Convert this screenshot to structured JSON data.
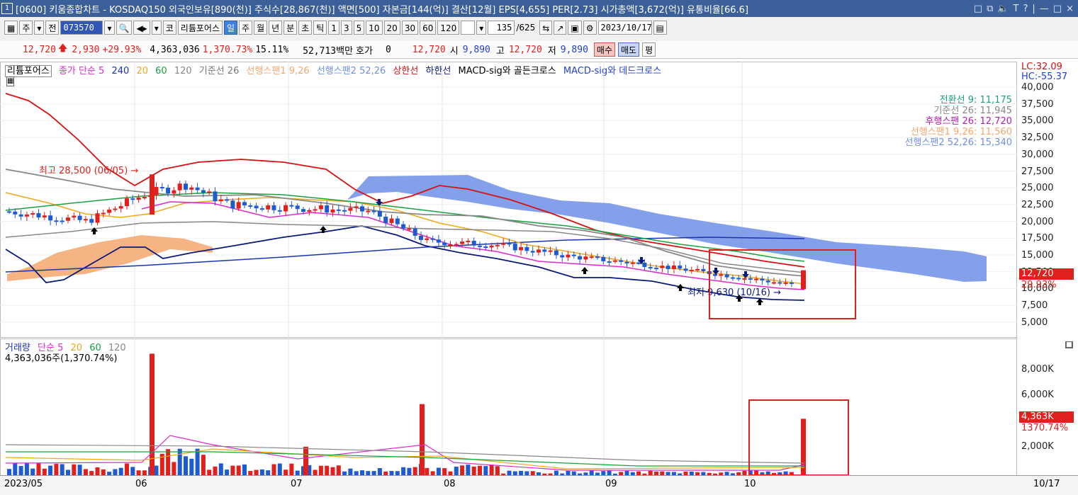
{
  "window": {
    "icon": "1",
    "title": "[0600] 키움종합차트 - KOSDAQ150 외국인보유[890(천)] 주식수[28,867(천)] 액면[500] 자본금[144(억)] 결산[12월] EPS[4,655] PER[2.73] 시가총액[3,672(억)] 유통비율[66.6]",
    "title_buttons": [
      "□",
      "⧉",
      "🔈",
      "T",
      "?",
      "|",
      "—",
      "□",
      "×"
    ]
  },
  "toolbar": {
    "period_select": "주",
    "prev_label": "전",
    "code_value": "073570",
    "market_btn": "코",
    "stock_name": "리튬포어스",
    "period_tabs": [
      "일",
      "주",
      "월",
      "년",
      "분",
      "초",
      "틱"
    ],
    "selected_tab": "일",
    "minute_options": [
      "1",
      "3",
      "5",
      "10",
      "20",
      "30",
      "60",
      "120"
    ],
    "count_value": "135",
    "count_total": "/625",
    "date_value": "2023/10/17"
  },
  "info": {
    "price": "12,720",
    "change": "2,930",
    "change_pct": "+29.93%",
    "volume": "4,363,036",
    "volume_ratio": "1,370.73%",
    "turnover": "15.11%",
    "trade_value": "52,713백만",
    "hoga_label": "호가",
    "hoga_value": "0",
    "price2": "12,720",
    "open_label": "시",
    "open": "9,890",
    "high_label": "고",
    "high": "12,720",
    "low_label": "저",
    "low": "9,890",
    "buy": "매수",
    "sell": "매도",
    "pyeong": "평"
  },
  "price_legend": {
    "name": "리튬포어스",
    "close_ma": "종가 단순 5",
    "ma240": "240",
    "ma20": "20",
    "ma60": "60",
    "ma120": "120",
    "kijun": "기준선 26",
    "span1": "선행스팬1 9,26",
    "span2": "선행스팬2 52,26",
    "upper": "상한선",
    "lower": "하한선",
    "macd_golden": "MACD-sig와 골든크로스",
    "macd_dead": "MACD-sig와 데드크로스"
  },
  "ichimoku_labels": {
    "tenkan": "전환선 9: 11,175",
    "kijun": "기준선 26: 11,945",
    "chikou": "후행스팬 26: 12,720",
    "span1": "선행스팬1 9,26: 11,560",
    "span2": "선행스팬2 52,26: 15,340"
  },
  "annotations": {
    "high": "최고 28,500 (06/05) →",
    "low": "최저 9,630 (10/16) →"
  },
  "price_axis": {
    "lc": "LC:32.09",
    "hc": "HC:-55.37",
    "ticks": [
      "40,000",
      "37,500",
      "35,000",
      "32,500",
      "30,000",
      "27,500",
      "25,000",
      "22,500",
      "20,000",
      "17,500",
      "15,000",
      "12,500",
      "10,000",
      "7,500",
      "5,000"
    ],
    "current": "12,720",
    "current_pct": "29.93%"
  },
  "volume_legend": {
    "name": "거래량",
    "ma": "단순 5",
    "ma20": "20",
    "ma60": "60",
    "ma120": "120",
    "value": "4,363,036주(1,370.74%)"
  },
  "volume_axis": {
    "ticks": [
      "8,000K",
      "6,000K",
      "4,000K",
      "2,000K"
    ],
    "current": "4,363K",
    "current_pct": "1370.74%"
  },
  "x_axis": {
    "labels": [
      "2023/05",
      "06",
      "07",
      "08",
      "09",
      "10"
    ],
    "right": "10/17"
  },
  "colors": {
    "up": "#e0201c",
    "down": "#1f5bd0",
    "cloud_up": "#f4a66f",
    "cloud_down": "#6f8fe6",
    "upper_band": "#d81010",
    "lower_band": "#0b1a7a",
    "ma240": "#1a34b0",
    "ma20": "#f0a818",
    "ma60": "#18a040",
    "ma5": "#e028d0",
    "kijun": "#888888",
    "highlight": "#e02020"
  }
}
